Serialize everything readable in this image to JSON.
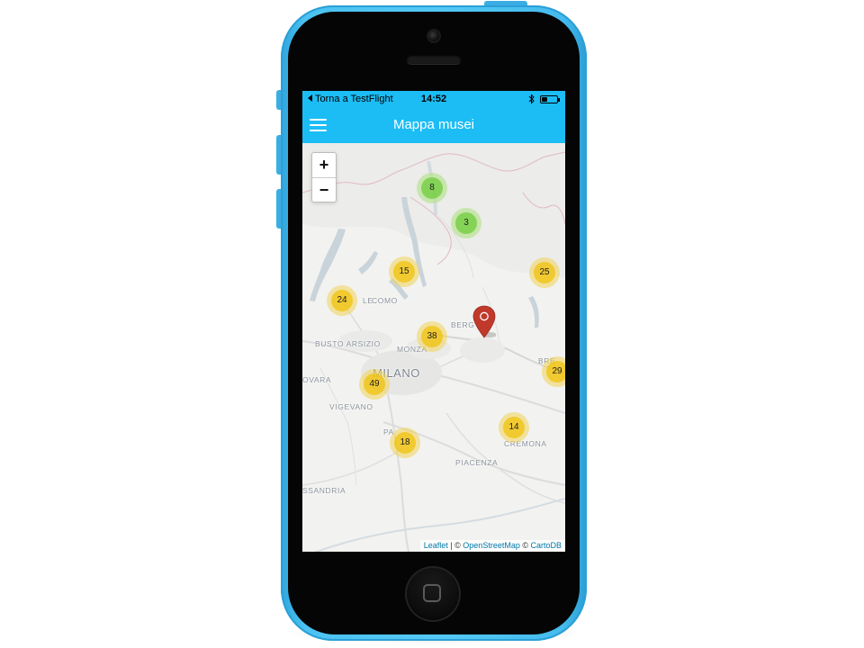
{
  "status_bar": {
    "back_label": "Torna a TestFlight",
    "time": "14:52",
    "battery_level": 0.4
  },
  "nav": {
    "title": "Mappa musei",
    "menu_icon": "hamburger-icon"
  },
  "map": {
    "zoom_in": "+",
    "zoom_out": "−",
    "cities": {
      "como": "COMO",
      "busto_arsizio": "BUSTO ARSIZIO",
      "monza": "MONZA",
      "milano": "MILANO",
      "novara": "OVARA",
      "vigevano": "VIGEVANO",
      "bergamo": "BERG",
      "brescia": "BRE",
      "cremona": "CREMONA",
      "piacenza": "PIACENZA",
      "alessandria": "SSANDRIA",
      "pavia": "PA",
      "lecco": "LE"
    },
    "clusters": [
      {
        "count": "8",
        "color": "green"
      },
      {
        "count": "3",
        "color": "green"
      },
      {
        "count": "15",
        "color": "yellow"
      },
      {
        "count": "25",
        "color": "yellow"
      },
      {
        "count": "24",
        "color": "yellow"
      },
      {
        "count": "38",
        "color": "yellow"
      },
      {
        "count": "49",
        "color": "yellow"
      },
      {
        "count": "29",
        "color": "yellow"
      },
      {
        "count": "14",
        "color": "yellow"
      },
      {
        "count": "18",
        "color": "yellow"
      }
    ],
    "marker_color": "#c0392b",
    "attribution": {
      "leaflet": "Leaflet",
      "sep1": " | © ",
      "osm": "OpenStreetMap",
      "sep2": " © ",
      "carto": "CartoDB"
    }
  },
  "colors": {
    "accent": "#1cbdf5",
    "phone_shell": "#4cc2f2"
  }
}
